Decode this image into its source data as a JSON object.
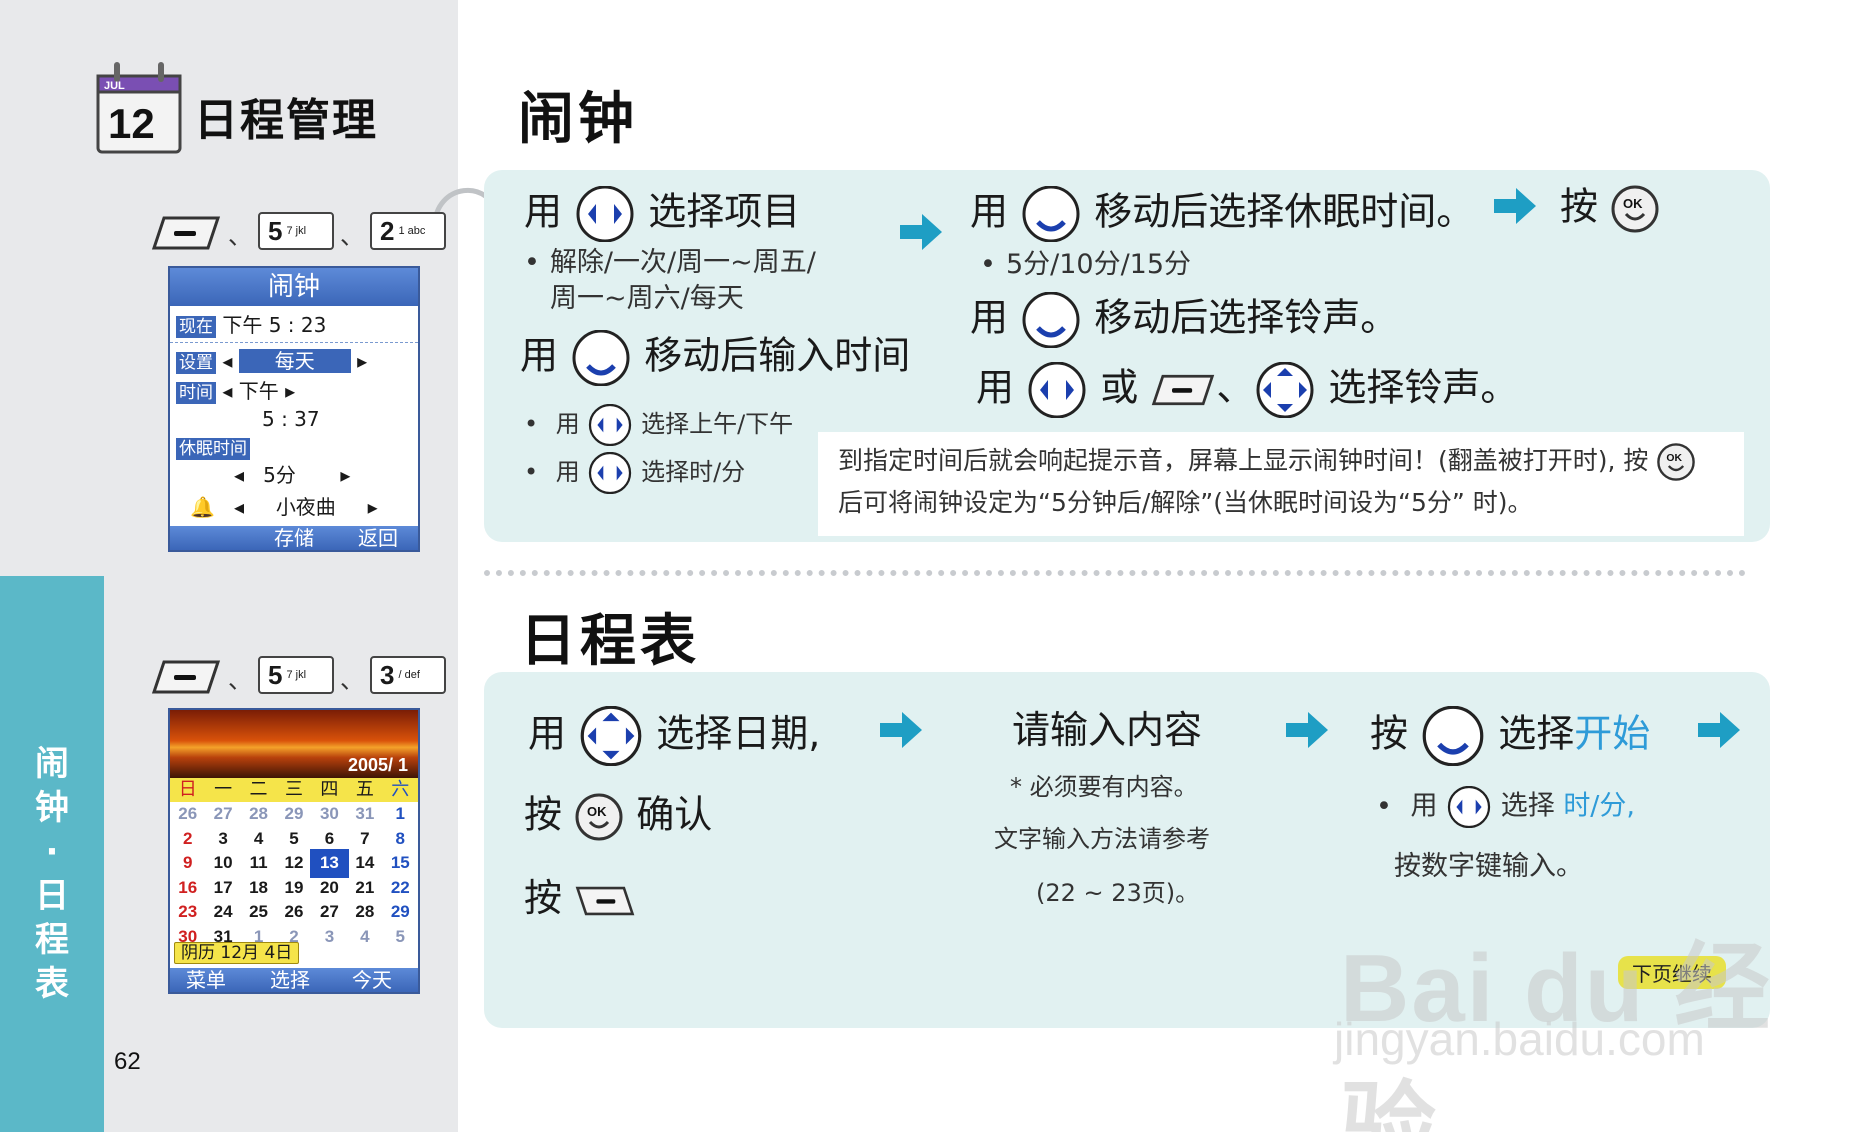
{
  "sidebar": {
    "section_title": "日程管理",
    "calendar_icon_month": "JUL",
    "calendar_icon_day": "12",
    "tab_text_lines": [
      "闹",
      "钟",
      "·",
      "日",
      "程",
      "表"
    ],
    "page_number": "62"
  },
  "alarm_keys": {
    "key1_digit": "5",
    "key1_sub": "7 jkl",
    "key2_digit": "2",
    "key2_sub": "1 abc",
    "separator": "、"
  },
  "schedule_keys": {
    "key1_digit": "5",
    "key1_sub": "7 jkl",
    "key2_digit": "3",
    "key2_sub": "/ def",
    "separator": "、"
  },
  "alarm_screen": {
    "title": "闹钟",
    "now_label": "现在",
    "now_value": "下午 5 : 23",
    "setting_label": "设置",
    "setting_value": "每天",
    "time_label": "时间",
    "time_ampm": "下午",
    "time_value": "5 : 37",
    "snooze_label": "休眠时间",
    "snooze_value": "5分",
    "ringtone_value": "小夜曲",
    "footer_save": "存储",
    "footer_back": "返回"
  },
  "calendar_screen": {
    "year_month": "2005/ 1",
    "weekdays": [
      "日",
      "一",
      "二",
      "三",
      "四",
      "五",
      "六"
    ],
    "days": [
      [
        "26",
        "27",
        "28",
        "29",
        "30",
        "31",
        "1"
      ],
      [
        "2",
        "3",
        "4",
        "5",
        "6",
        "7",
        "8"
      ],
      [
        "9",
        "10",
        "11",
        "12",
        "13",
        "14",
        "15"
      ],
      [
        "16",
        "17",
        "18",
        "19",
        "20",
        "21",
        "22"
      ],
      [
        "23",
        "24",
        "25",
        "26",
        "27",
        "28",
        "29"
      ],
      [
        "30",
        "31",
        "1",
        "2",
        "3",
        "4",
        "5"
      ]
    ],
    "lunar": "阴历 12月 4日",
    "footer_menu": "菜单",
    "footer_select": "选择",
    "footer_today": "今天"
  },
  "alarm": {
    "heading": "闹钟",
    "step1_pre": "用",
    "step1_post": "选择项目",
    "step1_bullet_line1": "解除/一次/周一~周五/",
    "step1_bullet_line2": "周一~周六/每天",
    "step2_pre": "用",
    "step2_post": "移动后输入时间",
    "step2_b1_pre": "用",
    "step2_b1_post": "选择上午/下午",
    "step2_b2_pre": "用",
    "step2_b2_post": "选择时/分",
    "step3_pre": "用",
    "step3_post": "移动后选择休眠时间。",
    "step3_press": "按",
    "step3_bullet": "5分/10分/15分",
    "step4_pre": "用",
    "step4_post": "移动后选择铃声。",
    "step5_pre": "用",
    "step5_or": "或",
    "step5_sep": "、",
    "step5_post": "选择铃声。",
    "note_line1": "到指定时间后就会响起提示音，屏幕上显示闹钟时间！(翻盖被打开时), 按",
    "note_line2": "后可将闹钟设定为“5分钟后/解除”(当休眠时间设为“5分” 时)。"
  },
  "schedule": {
    "heading": "日程表",
    "s1_pre": "用",
    "s1_post": "选择日期,",
    "s1_press": "按",
    "s1_confirm": "确认",
    "s1_press2": "按",
    "s2_title": "请输入内容",
    "s2_note": "* 必须要有内容。",
    "s2_ref": "文字输入方法请参考",
    "s2_pages": "(22 ~ 23页)。",
    "s3_press": "按",
    "s3_select": "选择",
    "s3_start": "开始",
    "s3_bullet_pre": "用",
    "s3_bullet_mid": "选择",
    "s3_bullet_post": "时/分,",
    "s3_line2": "按数字键输入。",
    "continue": "下页继续"
  },
  "watermark": {
    "brand": "Bai du 经验",
    "url": "jingyan.baidu.com"
  },
  "colors": {
    "panel": "#e1f1f1",
    "tab": "#5bb8c8",
    "arrow": "#1e9ec4",
    "accent_blue": "#2e9bd8",
    "screen_blue": "#3b66b8"
  }
}
